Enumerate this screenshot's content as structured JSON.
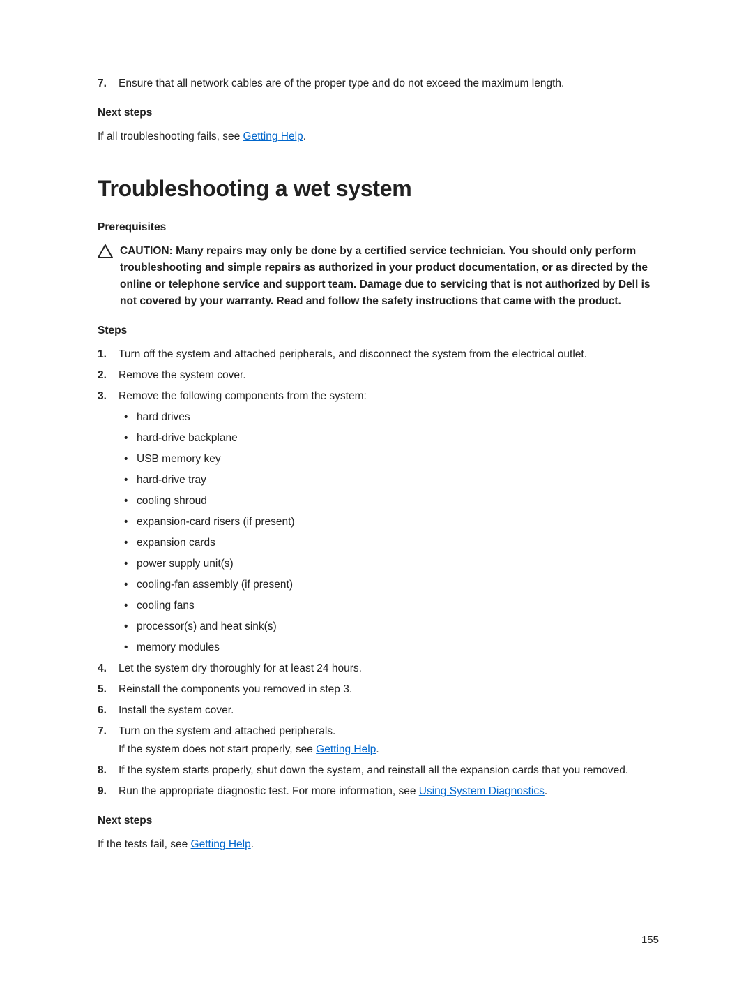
{
  "top": {
    "step7_num": "7.",
    "step7_text": "Ensure that all network cables are of the proper type and do not exceed the maximum length.",
    "next_steps_label": "Next steps",
    "next_steps_text_a": "If all troubleshooting fails, see ",
    "next_steps_link": "Getting Help",
    "next_steps_text_b": "."
  },
  "heading": "Troubleshooting a wet system",
  "prereq": {
    "label": "Prerequisites",
    "caution": "CAUTION: Many repairs may only be done by a certified service technician. You should only perform troubleshooting and simple repairs as authorized in your product documentation, or as directed by the online or telephone service and support team. Damage due to servicing that is not authorized by Dell is not covered by your warranty. Read and follow the safety instructions that came with the product."
  },
  "steps": {
    "label": "Steps",
    "s1_num": "1.",
    "s1": "Turn off the system and attached peripherals, and disconnect the system from the electrical outlet.",
    "s2_num": "2.",
    "s2": "Remove the system cover.",
    "s3_num": "3.",
    "s3": "Remove the following components from the system:",
    "bullets": [
      "hard drives",
      "hard-drive backplane",
      "USB memory key",
      "hard-drive tray",
      "cooling shroud",
      "expansion-card risers (if present)",
      "expansion cards",
      "power supply unit(s)",
      "cooling-fan assembly (if present)",
      "cooling fans",
      "processor(s) and heat sink(s)",
      "memory modules"
    ],
    "s4_num": "4.",
    "s4": "Let the system dry thoroughly for at least 24 hours.",
    "s5_num": "5.",
    "s5": "Reinstall the components you removed in step 3.",
    "s6_num": "6.",
    "s6": "Install the system cover.",
    "s7_num": "7.",
    "s7": "Turn on the system and attached peripherals.",
    "s7b_a": "If the system does not start properly, see ",
    "s7b_link": "Getting Help",
    "s7b_b": ".",
    "s8_num": "8.",
    "s8": "If the system starts properly, shut down the system, and reinstall all the expansion cards that you removed.",
    "s9_num": "9.",
    "s9_a": "Run the appropriate diagnostic test. For more information, see ",
    "s9_link": "Using System Diagnostics",
    "s9_b": "."
  },
  "next2": {
    "label": "Next steps",
    "a": "If the tests fail, see ",
    "link": "Getting Help",
    "b": "."
  },
  "page_number": "155"
}
